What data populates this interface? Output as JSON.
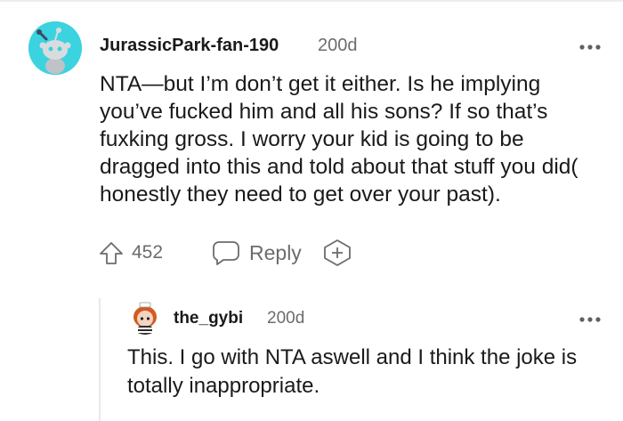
{
  "comment": {
    "username": "JurassicPark-fan-190",
    "age": "200d",
    "body": "NTA—but I’m don’t get it either. Is he implying you’ve fucked him and all his sons? If so that’s fuxking gross. I worry your kid is going to be dragged into this and told about that stuff you did( honestly they need to get over your past).",
    "upvotes": "452",
    "reply_label": "Reply",
    "more_icon": "more-horizontal-icon"
  },
  "reply": {
    "username": "the_gybi",
    "age": "200d",
    "body": "This. I go with NTA aswell and I think the joke is totally inappropriate.",
    "more_icon": "more-horizontal-icon"
  },
  "colors": {
    "avatar_bg": "#3bd3df",
    "meta_text": "#6c6c6c",
    "body_text": "#1a1a1b"
  }
}
